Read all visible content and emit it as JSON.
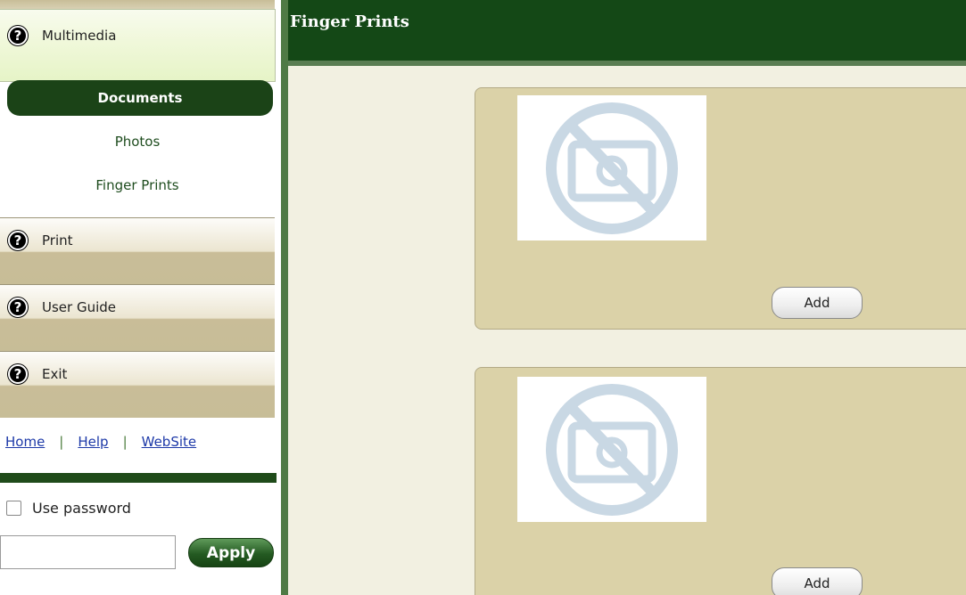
{
  "sidebar": {
    "multimedia": {
      "label": "Multimedia",
      "icon": "help-icon"
    },
    "subitems": [
      "Documents",
      "Photos",
      "Finger Prints"
    ],
    "active_subitem": "Documents",
    "sections": [
      {
        "label": "Print",
        "icon": "help-icon"
      },
      {
        "label": "User Guide",
        "icon": "help-icon"
      },
      {
        "label": "Exit",
        "icon": "help-icon"
      }
    ],
    "links": [
      "Home",
      "Help",
      "WebSite"
    ],
    "link_separator": "|",
    "password_label": "Use password",
    "password_value": "",
    "apply_label": "Apply"
  },
  "main": {
    "title": "Finger Prints",
    "cards": [
      {
        "add_label": "Add",
        "photo_icon": "no-photo-icon"
      },
      {
        "add_label": "Add",
        "photo_icon": "no-photo-icon"
      }
    ]
  },
  "colors": {
    "header_green": "#144816",
    "active_item": "#1b4317",
    "card_tan": "#dbd2a8",
    "main_bg": "#f2f0e1",
    "link_blue": "#1d39a8"
  }
}
